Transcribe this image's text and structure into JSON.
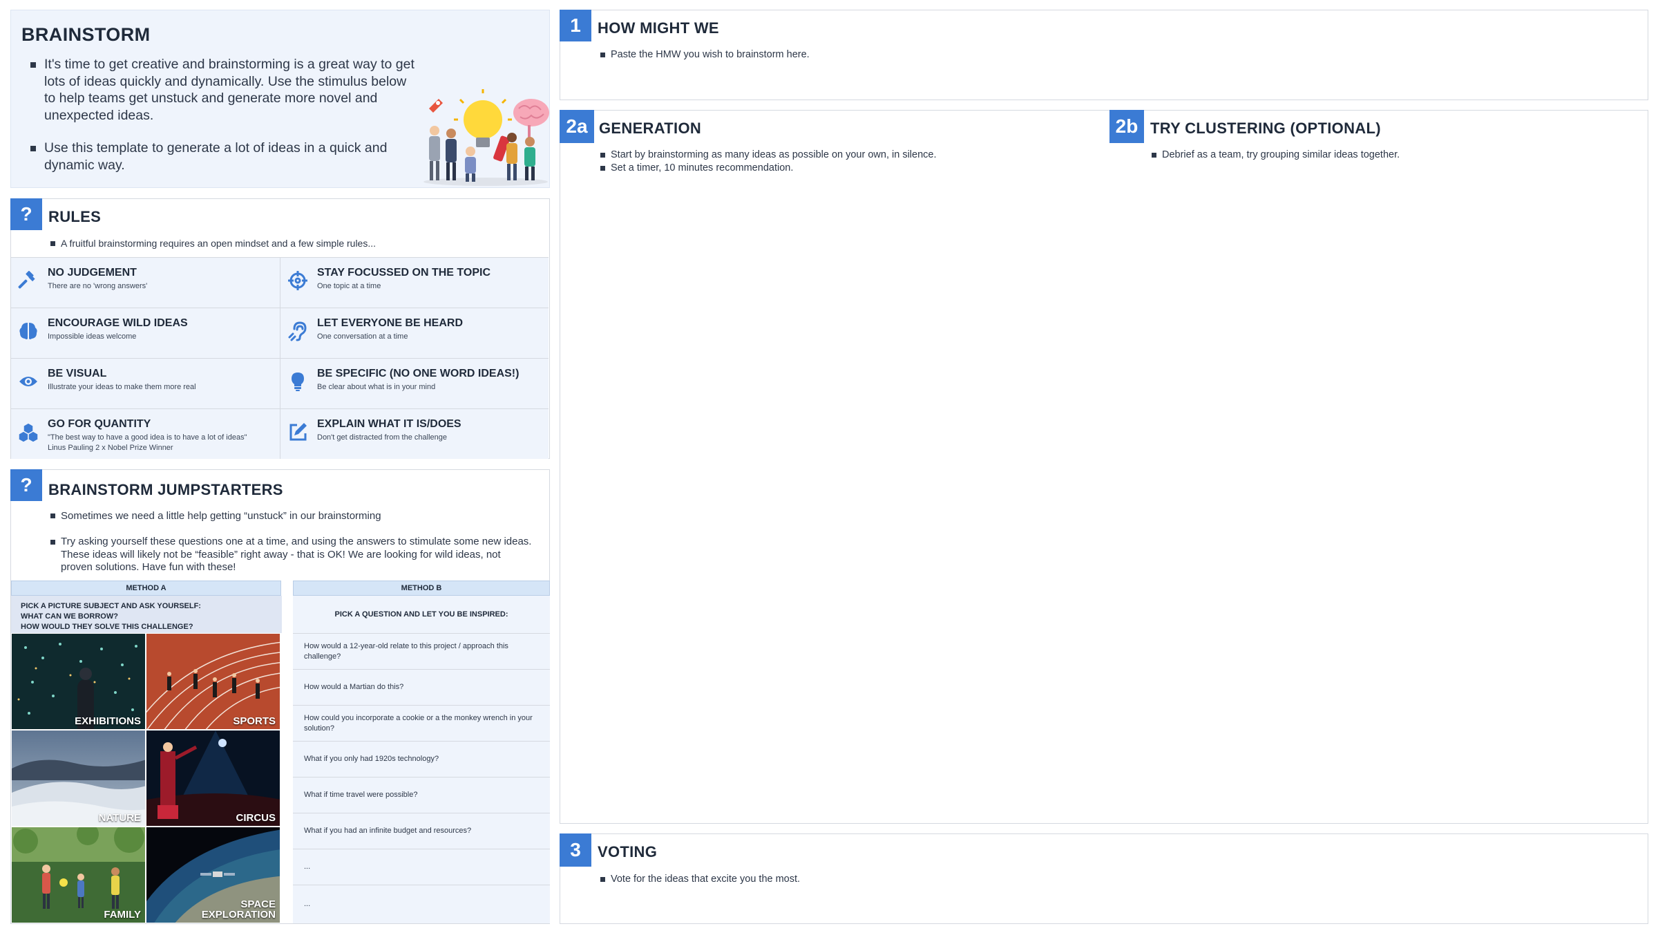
{
  "intro": {
    "title": "BRAINSTORM",
    "bullets": [
      "It's time to get creative and brainstorming is a great way to get lots of ideas quickly and dynamically. Use the stimulus below to help teams get unstuck and generate more novel and unexpected ideas.",
      "Use this template to generate a lot of ideas in a quick and dynamic way."
    ],
    "illustration": "team-brainstorm-illustration"
  },
  "rules": {
    "badge": "?",
    "title": "RULES",
    "intro": "A fruitful brainstorming requires an open mindset and a few simple rules...",
    "items": [
      {
        "title": "NO JUDGEMENT",
        "subtitle": "There are no 'wrong answers'",
        "icon": "gavel-icon"
      },
      {
        "title": "STAY FOCUSSED ON THE TOPIC",
        "subtitle": "One topic at a time",
        "icon": "crosshair-icon"
      },
      {
        "title": "ENCOURAGE WILD IDEAS",
        "subtitle": "Impossible ideas welcome",
        "icon": "brain-icon"
      },
      {
        "title": "LET EVERYONE BE HEARD",
        "subtitle": "One conversation at a time",
        "icon": "ear-icon"
      },
      {
        "title": "BE VISUAL",
        "subtitle": "Illustrate your ideas to make them more real",
        "icon": "eye-icon"
      },
      {
        "title": "BE SPECIFIC (NO ONE WORD IDEAS!)",
        "subtitle": "Be clear about what is in your mind",
        "icon": "lightbulb-icon"
      },
      {
        "title": "GO FOR QUANTITY",
        "subtitle": "\"The best way to have a good idea is to have a lot of ideas\" Linus Pauling 2 x Nobel Prize Winner",
        "icon": "cubes-icon"
      },
      {
        "title": "EXPLAIN WHAT IT IS/DOES",
        "subtitle": "Don't get distracted from the challenge",
        "icon": "edit-icon"
      }
    ]
  },
  "jumpstarters": {
    "badge": "?",
    "title": "BRAINSTORM JUMPSTARTERS",
    "bullets": [
      "Sometimes we need a little help getting “unstuck” in our brainstorming",
      "Try asking yourself these questions one at a time, and using the answers to stimulate some new ideas. These ideas will likely not be “feasible” right away - that is OK! We are looking for wild ideas, not proven solutions. Have fun with these!"
    ],
    "method_a": {
      "header": "METHOD A",
      "prompt_lines": [
        "PICK A PICTURE SUBJECT AND ASK YOURSELF:",
        "WHAT CAN WE BORROW?",
        "HOW WOULD THEY SOLVE THIS CHALLENGE?"
      ],
      "tiles": [
        "EXHIBITIONS",
        "SPORTS",
        "NATURE",
        "CIRCUS",
        "FAMILY",
        "SPACE EXPLORATION"
      ]
    },
    "method_b": {
      "header": "METHOD B",
      "prompt": "PICK A QUESTION AND LET YOU BE INSPIRED:",
      "questions": [
        "How would a 12-year-old relate to this project / approach this challenge?",
        "How would a Martian do this?",
        "How could you incorporate a cookie or a the monkey wrench in your solution?",
        "What if you only had 1920s technology?",
        "What if time travel were possible?",
        "What if you had an infinite budget and resources?",
        "...",
        "..."
      ]
    }
  },
  "hmw": {
    "badge": "1",
    "title": "HOW MIGHT WE",
    "bullet": "Paste the HMW you wish to brainstorm here."
  },
  "generation": {
    "badge": "2a",
    "title": "GENERATION",
    "bullets": [
      "Start by brainstorming as many ideas as possible on your own, in silence.",
      "Set a timer, 10 minutes recommendation."
    ]
  },
  "clustering": {
    "badge": "2b",
    "title": "TRY CLUSTERING (OPTIONAL)",
    "bullet": "Debrief as a team, try grouping similar ideas together."
  },
  "voting": {
    "badge": "3",
    "title": "VOTING",
    "bullet": "Vote for the ideas that excite you the most."
  },
  "colors": {
    "accent": "#3b7bd4",
    "panel_tint": "#eff4fc",
    "border": "#d5d9e0",
    "text": "#1f2a3a"
  }
}
